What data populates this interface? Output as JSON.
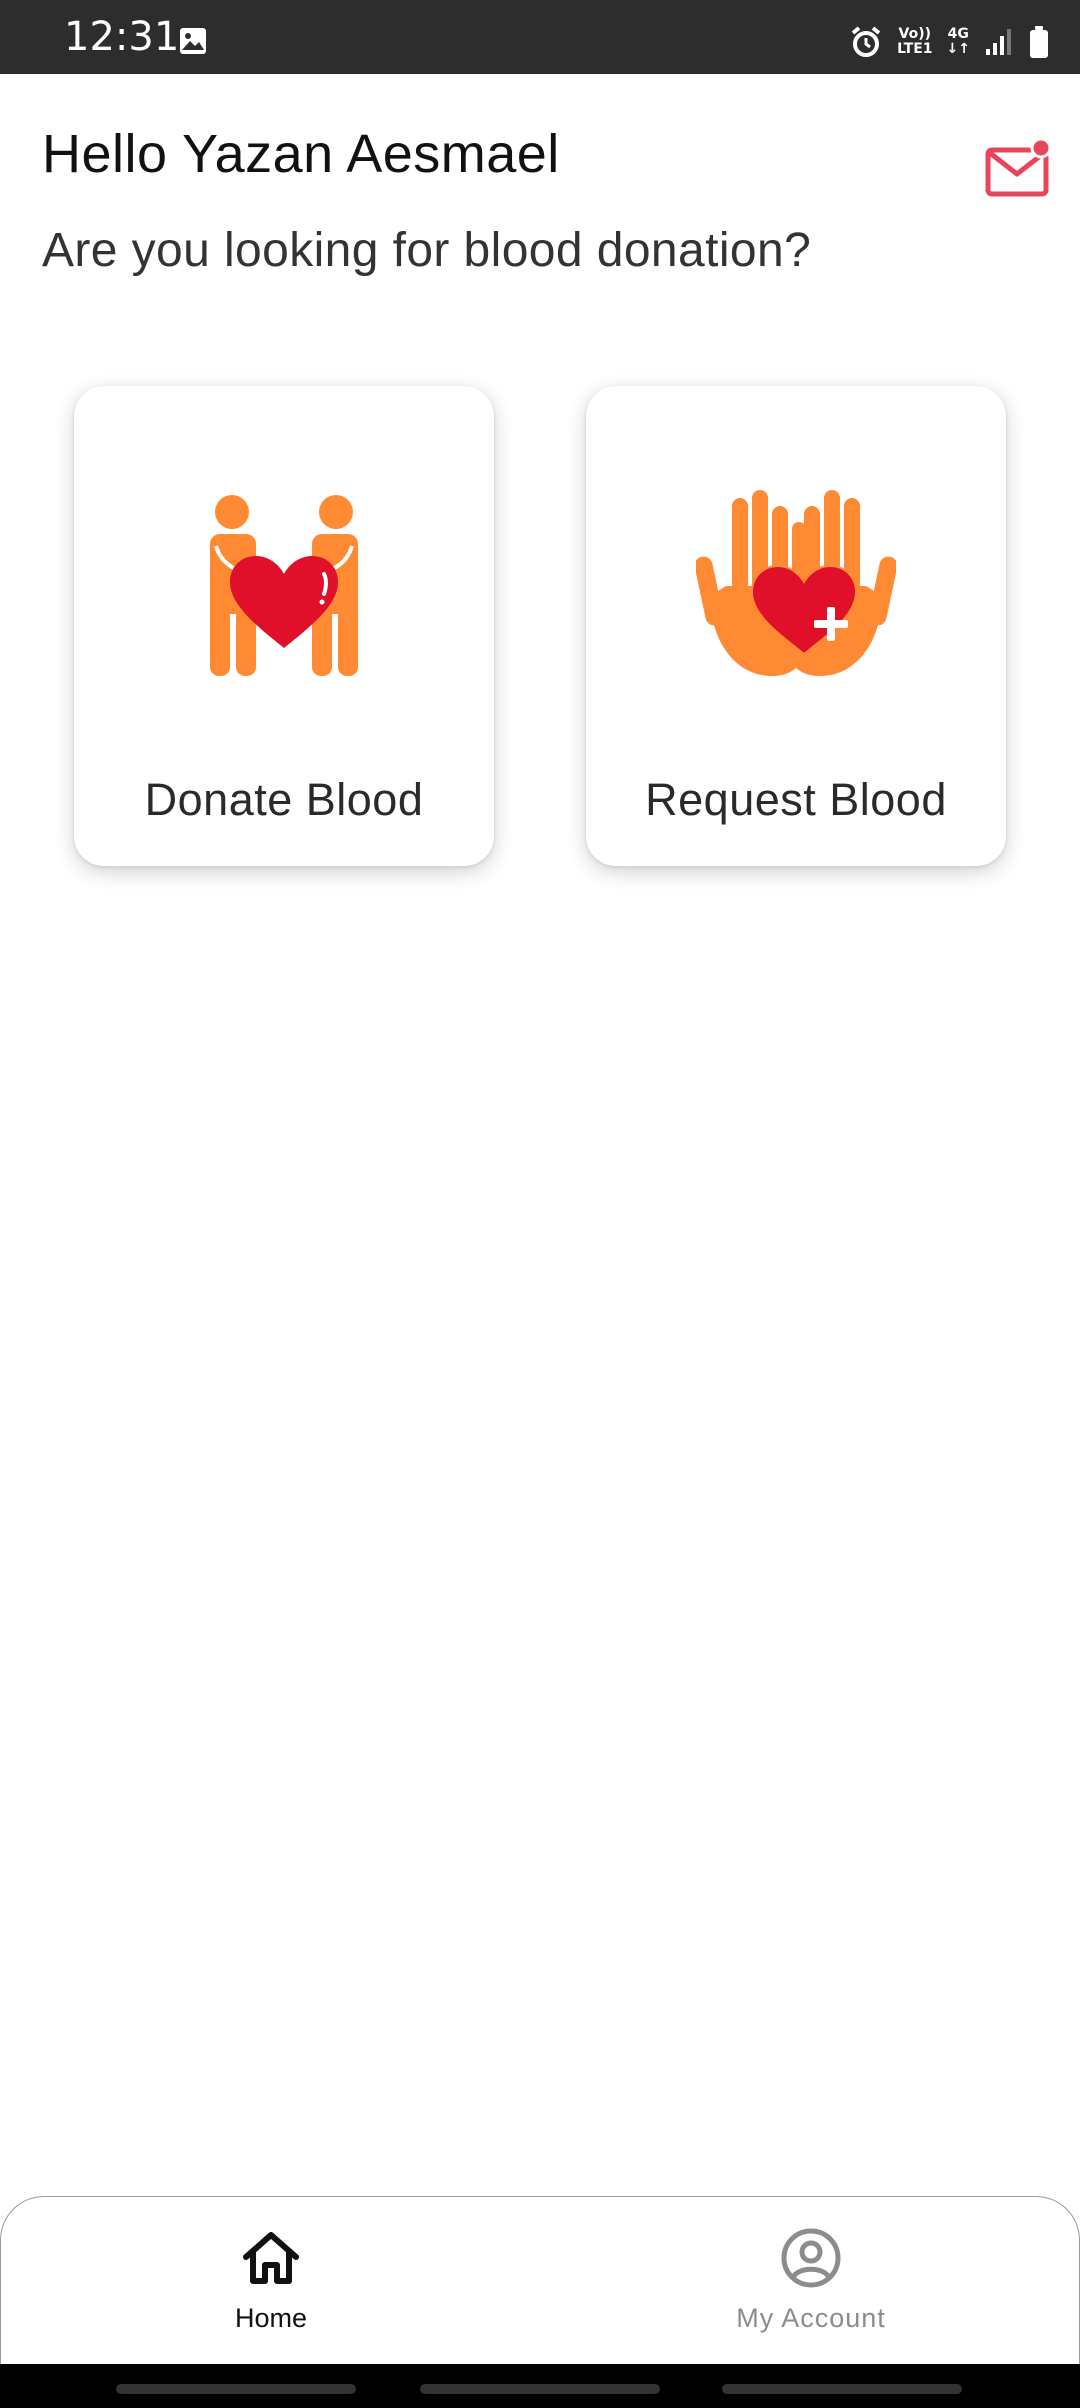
{
  "status_bar": {
    "time": "12:31",
    "icons": [
      "gallery-icon",
      "alarm-icon",
      "volte-icon",
      "4g-icon",
      "signal-icon",
      "battery-icon"
    ],
    "net_label_top": "Vo))",
    "net_label_bottom": "LTE1",
    "net_4g_top": "4G",
    "net_4g_bottom": "↓↑"
  },
  "header": {
    "greeting": "Hello Yazan Aesmael",
    "subtitle": "Are you looking for blood donation?",
    "mail_icon": "mail-icon"
  },
  "cards": [
    {
      "label": "Donate Blood",
      "icon": "donate-people-heart-icon"
    },
    {
      "label": "Request Blood",
      "icon": "hands-heart-plus-icon"
    }
  ],
  "bottom_nav": {
    "items": [
      {
        "label": "Home",
        "icon": "home-icon",
        "selected": true
      },
      {
        "label": "My Account",
        "icon": "account-circle-icon",
        "selected": false
      }
    ]
  },
  "colors": {
    "accent_red": "#e0102a",
    "accent_orange": "#ff8a33",
    "mail_red": "#e8455a"
  }
}
